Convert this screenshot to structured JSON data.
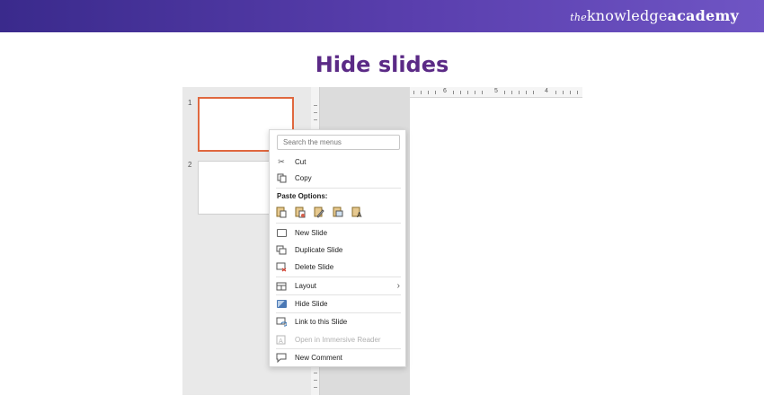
{
  "banner": {
    "brand_the": "the",
    "brand_knowledge": "knowledge",
    "brand_academy": "academy"
  },
  "page_title": "Hide slides",
  "slides": [
    {
      "number": "1",
      "selected": true
    },
    {
      "number": "2",
      "selected": false
    }
  ],
  "ruler": {
    "labels": [
      "6",
      "5",
      "4"
    ]
  },
  "context_menu": {
    "search_placeholder": "Search the menus",
    "items": {
      "cut": {
        "label": "Cut",
        "icon": "scissors-icon"
      },
      "copy": {
        "label": "Copy",
        "icon": "copy-icon"
      },
      "paste_options": {
        "label": "Paste Options:"
      },
      "new_slide": {
        "label": "New Slide",
        "icon": "new-slide-icon"
      },
      "duplicate_slide": {
        "label": "Duplicate Slide",
        "icon": "duplicate-slide-icon"
      },
      "delete_slide": {
        "label": "Delete Slide",
        "icon": "delete-slide-icon"
      },
      "layout": {
        "label": "Layout",
        "icon": "layout-icon"
      },
      "hide_slide": {
        "label": "Hide Slide",
        "icon": "hide-slide-icon"
      },
      "link_slide": {
        "label": "Link to this Slide",
        "icon": "link-slide-icon"
      },
      "immersive_reader": {
        "label": "Open in Immersive Reader",
        "icon": "immersive-reader-icon",
        "disabled": true
      },
      "new_comment": {
        "label": "New Comment",
        "icon": "comment-icon"
      }
    },
    "paste_icons": [
      "paste-keep-source-icon",
      "paste-destination-theme-icon",
      "paste-embed-icon",
      "paste-picture-icon",
      "paste-keep-text-icon"
    ]
  },
  "colors": {
    "banner": "#4b349f",
    "title": "#5b2a86",
    "selected_thumb": "#e0683f",
    "thumb_pane": "#e9e9e9"
  }
}
